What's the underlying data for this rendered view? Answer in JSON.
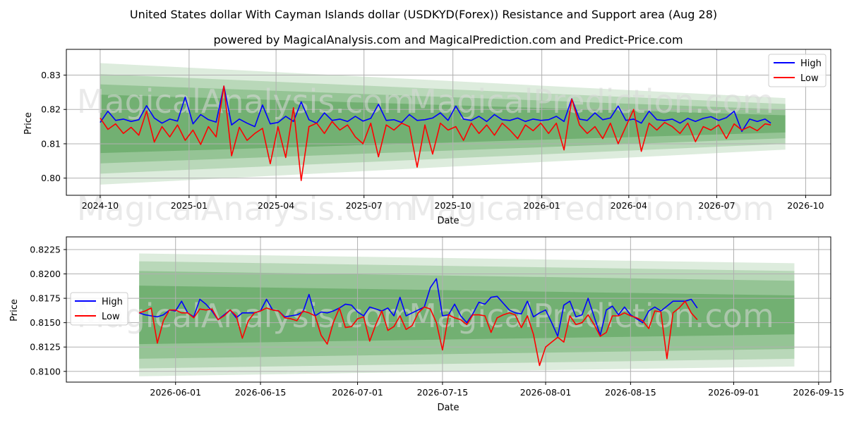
{
  "figure": {
    "title": "United States dollar With Cayman Islands dollar (USDKYD(Forex)) Resistance and Support area (Aug 28)",
    "subtitle": "powered by MagicalAnalysis.com and MagicalPrediction.com and Predict-Price.com",
    "watermarks": [
      "MagicalAnalysis.com",
      "MagicalPrediction.com"
    ]
  },
  "colors": {
    "high": "#0000ff",
    "low": "#ff0000",
    "band": "#2e8b2e",
    "grid": "#b0b0b0"
  },
  "chart_data": [
    {
      "type": "line",
      "xlabel": "Date",
      "ylabel": "Price",
      "x_ticks": [
        "2024-10",
        "2025-01",
        "2025-04",
        "2025-07",
        "2025-10",
        "2026-01",
        "2026-04",
        "2026-07",
        "2026-10"
      ],
      "y_ticks": [
        "0.80",
        "0.81",
        "0.82",
        "0.83"
      ],
      "ylim": [
        0.795,
        0.8375
      ],
      "grid": true,
      "legend": "top-right",
      "bands": {
        "x_range": [
          "2024-10-01",
          "2026-09-10"
        ],
        "center": 0.8158,
        "start_half_widths": [
          0.0177,
          0.0145,
          0.0115,
          0.0085
        ],
        "end_half_widths": [
          0.0075,
          0.0058,
          0.0042,
          0.0025
        ]
      },
      "series": [
        {
          "name": "High",
          "color": "#0000ff",
          "dates": [
            "2024-10-01",
            "2024-10-09",
            "2024-10-17",
            "2024-10-25",
            "2024-11-02",
            "2024-11-10",
            "2024-11-18",
            "2024-11-26",
            "2024-12-04",
            "2024-12-12",
            "2024-12-20",
            "2024-12-28",
            "2025-01-05",
            "2025-01-13",
            "2025-01-21",
            "2025-01-29",
            "2025-02-06",
            "2025-02-14",
            "2025-02-22",
            "2025-03-02",
            "2025-03-10",
            "2025-03-18",
            "2025-03-26",
            "2025-04-03",
            "2025-04-11",
            "2025-04-19",
            "2025-04-27",
            "2025-05-05",
            "2025-05-13",
            "2025-05-21",
            "2025-05-29",
            "2025-06-06",
            "2025-06-14",
            "2025-06-22",
            "2025-06-30",
            "2025-07-08",
            "2025-07-16",
            "2025-07-24",
            "2025-08-01",
            "2025-08-09",
            "2025-08-17",
            "2025-08-25",
            "2025-09-02",
            "2025-09-10",
            "2025-09-18",
            "2025-09-26",
            "2025-10-04",
            "2025-10-12",
            "2025-10-20",
            "2025-10-28",
            "2025-11-05",
            "2025-11-13",
            "2025-11-21",
            "2025-11-29",
            "2025-12-07",
            "2025-12-15",
            "2025-12-23",
            "2025-12-31",
            "2026-01-08",
            "2026-01-16",
            "2026-01-24",
            "2026-02-01",
            "2026-02-09",
            "2026-02-17",
            "2026-02-25",
            "2026-03-05",
            "2026-03-13",
            "2026-03-21",
            "2026-03-29",
            "2026-04-06",
            "2026-04-14",
            "2026-04-22",
            "2026-04-30",
            "2026-05-08",
            "2026-05-16",
            "2026-05-24",
            "2026-06-01",
            "2026-06-09",
            "2026-06-17",
            "2026-06-25",
            "2026-07-03",
            "2026-07-11",
            "2026-07-19",
            "2026-07-27",
            "2026-08-04",
            "2026-08-12",
            "2026-08-20",
            "2026-08-26"
          ],
          "values": [
            0.8162,
            0.8195,
            0.8168,
            0.8172,
            0.8165,
            0.817,
            0.8211,
            0.8175,
            0.816,
            0.8172,
            0.8166,
            0.8236,
            0.8158,
            0.8185,
            0.817,
            0.8163,
            0.8268,
            0.8155,
            0.8172,
            0.816,
            0.815,
            0.8213,
            0.8158,
            0.8162,
            0.818,
            0.8165,
            0.8222,
            0.817,
            0.816,
            0.819,
            0.8168,
            0.8172,
            0.8165,
            0.818,
            0.8166,
            0.8174,
            0.8215,
            0.8168,
            0.817,
            0.8162,
            0.8185,
            0.8168,
            0.817,
            0.8175,
            0.819,
            0.8168,
            0.821,
            0.8172,
            0.8168,
            0.818,
            0.8165,
            0.8185,
            0.817,
            0.8168,
            0.8175,
            0.8165,
            0.8172,
            0.8168,
            0.817,
            0.818,
            0.8165,
            0.8231,
            0.8172,
            0.8168,
            0.819,
            0.817,
            0.8175,
            0.821,
            0.8168,
            0.8172,
            0.816,
            0.8195,
            0.817,
            0.8168,
            0.8172,
            0.816,
            0.8174,
            0.8165,
            0.8174,
            0.8179,
            0.8168,
            0.8176,
            0.8195,
            0.8136,
            0.8172,
            0.8165,
            0.8172,
            0.816
          ]
        },
        {
          "name": "Low",
          "color": "#ff0000",
          "dates": [
            "2024-10-01",
            "2024-10-09",
            "2024-10-17",
            "2024-10-25",
            "2024-11-02",
            "2024-11-10",
            "2024-11-18",
            "2024-11-26",
            "2024-12-04",
            "2024-12-12",
            "2024-12-20",
            "2024-12-28",
            "2025-01-05",
            "2025-01-13",
            "2025-01-21",
            "2025-01-29",
            "2025-02-06",
            "2025-02-14",
            "2025-02-22",
            "2025-03-02",
            "2025-03-10",
            "2025-03-18",
            "2025-03-26",
            "2025-04-03",
            "2025-04-11",
            "2025-04-19",
            "2025-04-27",
            "2025-05-05",
            "2025-05-13",
            "2025-05-21",
            "2025-05-29",
            "2025-06-06",
            "2025-06-14",
            "2025-06-22",
            "2025-06-30",
            "2025-07-08",
            "2025-07-16",
            "2025-07-24",
            "2025-08-01",
            "2025-08-09",
            "2025-08-17",
            "2025-08-25",
            "2025-09-02",
            "2025-09-10",
            "2025-09-18",
            "2025-09-26",
            "2025-10-04",
            "2025-10-12",
            "2025-10-20",
            "2025-10-28",
            "2025-11-05",
            "2025-11-13",
            "2025-11-21",
            "2025-11-29",
            "2025-12-07",
            "2025-12-15",
            "2025-12-23",
            "2025-12-31",
            "2026-01-08",
            "2026-01-16",
            "2026-01-24",
            "2026-02-01",
            "2026-02-09",
            "2026-02-17",
            "2026-02-25",
            "2026-03-05",
            "2026-03-13",
            "2026-03-21",
            "2026-03-29",
            "2026-04-06",
            "2026-04-14",
            "2026-04-22",
            "2026-04-30",
            "2026-05-08",
            "2026-05-16",
            "2026-05-24",
            "2026-06-01",
            "2026-06-09",
            "2026-06-17",
            "2026-06-25",
            "2026-07-03",
            "2026-07-11",
            "2026-07-19",
            "2026-07-27",
            "2026-08-04",
            "2026-08-12",
            "2026-08-20",
            "2026-08-26"
          ],
          "values": [
            0.8175,
            0.8142,
            0.8158,
            0.813,
            0.8148,
            0.8125,
            0.8195,
            0.8105,
            0.815,
            0.812,
            0.8155,
            0.811,
            0.814,
            0.8098,
            0.815,
            0.812,
            0.8268,
            0.8065,
            0.8148,
            0.811,
            0.813,
            0.8145,
            0.8042,
            0.815,
            0.806,
            0.8205,
            0.7993,
            0.815,
            0.816,
            0.813,
            0.8165,
            0.814,
            0.8155,
            0.812,
            0.81,
            0.816,
            0.8062,
            0.8155,
            0.814,
            0.816,
            0.815,
            0.8032,
            0.8155,
            0.807,
            0.816,
            0.814,
            0.815,
            0.811,
            0.816,
            0.813,
            0.8155,
            0.8125,
            0.816,
            0.814,
            0.8115,
            0.8155,
            0.8138,
            0.816,
            0.813,
            0.816,
            0.8082,
            0.823,
            0.8155,
            0.813,
            0.815,
            0.8115,
            0.816,
            0.81,
            0.815,
            0.82,
            0.8078,
            0.816,
            0.814,
            0.8162,
            0.815,
            0.813,
            0.816,
            0.8106,
            0.815,
            0.814,
            0.8155,
            0.8115,
            0.8158,
            0.814,
            0.815,
            0.8138,
            0.8158,
            0.8155
          ]
        }
      ]
    },
    {
      "type": "line",
      "xlabel": "Date",
      "ylabel": "Price",
      "x_ticks": [
        "2026-06-01",
        "2026-06-15",
        "2026-07-01",
        "2026-07-15",
        "2026-08-01",
        "2026-08-15",
        "2026-09-01",
        "2026-09-15"
      ],
      "y_ticks": [
        "0.8100",
        "0.8125",
        "0.8150",
        "0.8175",
        "0.8200",
        "0.8225"
      ],
      "ylim": [
        0.8089,
        0.8238
      ],
      "grid": true,
      "legend": "center-left",
      "bands": {
        "x_range": [
          "2026-05-26",
          "2026-09-11"
        ],
        "center": 0.8158,
        "start_half_widths": [
          0.0063,
          0.0055,
          0.0045,
          0.003
        ],
        "end_half_widths": [
          0.0053,
          0.0045,
          0.0035,
          0.002
        ]
      },
      "series": [
        {
          "name": "High",
          "color": "#0000ff",
          "dates": [
            "2026-05-26",
            "2026-05-27",
            "2026-05-28",
            "2026-05-29",
            "2026-05-30",
            "2026-05-31",
            "2026-06-01",
            "2026-06-02",
            "2026-06-03",
            "2026-06-04",
            "2026-06-05",
            "2026-06-06",
            "2026-06-07",
            "2026-06-08",
            "2026-06-09",
            "2026-06-10",
            "2026-06-11",
            "2026-06-12",
            "2026-06-13",
            "2026-06-14",
            "2026-06-15",
            "2026-06-16",
            "2026-06-17",
            "2026-06-18",
            "2026-06-19",
            "2026-06-20",
            "2026-06-21",
            "2026-06-22",
            "2026-06-23",
            "2026-06-24",
            "2026-06-25",
            "2026-06-26",
            "2026-06-27",
            "2026-06-28",
            "2026-06-29",
            "2026-06-30",
            "2026-07-01",
            "2026-07-02",
            "2026-07-03",
            "2026-07-04",
            "2026-07-05",
            "2026-07-06",
            "2026-07-07",
            "2026-07-08",
            "2026-07-09",
            "2026-07-10",
            "2026-07-11",
            "2026-07-12",
            "2026-07-13",
            "2026-07-14",
            "2026-07-15",
            "2026-07-16",
            "2026-07-17",
            "2026-07-18",
            "2026-07-19",
            "2026-07-20",
            "2026-07-21",
            "2026-07-22",
            "2026-07-23",
            "2026-07-24",
            "2026-07-25",
            "2026-07-26",
            "2026-07-27",
            "2026-07-28",
            "2026-07-29",
            "2026-07-30",
            "2026-07-31",
            "2026-08-01",
            "2026-08-02",
            "2026-08-03",
            "2026-08-04",
            "2026-08-05",
            "2026-08-06",
            "2026-08-07",
            "2026-08-08",
            "2026-08-09",
            "2026-08-10",
            "2026-08-11",
            "2026-08-12",
            "2026-08-13",
            "2026-08-14",
            "2026-08-15",
            "2026-08-16",
            "2026-08-17",
            "2026-08-18",
            "2026-08-19",
            "2026-08-20",
            "2026-08-21",
            "2026-08-22",
            "2026-08-23",
            "2026-08-24",
            "2026-08-25",
            "2026-08-26"
          ],
          "values": [
            0.816,
            0.8158,
            0.8157,
            0.8156,
            0.8158,
            0.8163,
            0.8162,
            0.8172,
            0.816,
            0.8156,
            0.8174,
            0.8169,
            0.8162,
            0.8153,
            0.8158,
            0.8163,
            0.8155,
            0.816,
            0.816,
            0.816,
            0.8162,
            0.8174,
            0.8163,
            0.8162,
            0.8156,
            0.8157,
            0.8158,
            0.8161,
            0.8179,
            0.8157,
            0.8161,
            0.816,
            0.8162,
            0.8165,
            0.8169,
            0.8168,
            0.8161,
            0.8157,
            0.8166,
            0.8164,
            0.8162,
            0.8165,
            0.8157,
            0.8176,
            0.8157,
            0.816,
            0.8163,
            0.8166,
            0.8186,
            0.8195,
            0.8157,
            0.8158,
            0.8169,
            0.8157,
            0.815,
            0.8159,
            0.8171,
            0.8169,
            0.8176,
            0.8177,
            0.817,
            0.8163,
            0.816,
            0.8159,
            0.8172,
            0.8156,
            0.816,
            0.8163,
            0.815,
            0.8136,
            0.8168,
            0.8172,
            0.8156,
            0.8158,
            0.8175,
            0.8156,
            0.8137,
            0.8163,
            0.8167,
            0.8158,
            0.8166,
            0.8158,
            0.8154,
            0.815,
            0.8162,
            0.8166,
            0.8162,
            0.8167,
            0.8172,
            0.8172,
            0.8172,
            0.8174,
            0.8165,
            0.816
          ],
          "note_dates_count": 93
        },
        {
          "name": "Low",
          "color": "#ff0000",
          "dates": [
            "2026-05-26",
            "2026-05-27",
            "2026-05-28",
            "2026-05-29",
            "2026-05-30",
            "2026-05-31",
            "2026-06-01",
            "2026-06-02",
            "2026-06-03",
            "2026-06-04",
            "2026-06-05",
            "2026-06-06",
            "2026-06-07",
            "2026-06-08",
            "2026-06-09",
            "2026-06-10",
            "2026-06-11",
            "2026-06-12",
            "2026-06-13",
            "2026-06-14",
            "2026-06-15",
            "2026-06-16",
            "2026-06-17",
            "2026-06-18",
            "2026-06-19",
            "2026-06-20",
            "2026-06-21",
            "2026-06-22",
            "2026-06-23",
            "2026-06-24",
            "2026-06-25",
            "2026-06-26",
            "2026-06-27",
            "2026-06-28",
            "2026-06-29",
            "2026-06-30",
            "2026-07-01",
            "2026-07-02",
            "2026-07-03",
            "2026-07-04",
            "2026-07-05",
            "2026-07-06",
            "2026-07-07",
            "2026-07-08",
            "2026-07-09",
            "2026-07-10",
            "2026-07-11",
            "2026-07-12",
            "2026-07-13",
            "2026-07-14",
            "2026-07-15",
            "2026-07-16",
            "2026-07-17",
            "2026-07-18",
            "2026-07-19",
            "2026-07-20",
            "2026-07-21",
            "2026-07-22",
            "2026-07-23",
            "2026-07-24",
            "2026-07-25",
            "2026-07-26",
            "2026-07-27",
            "2026-07-28",
            "2026-07-29",
            "2026-07-30",
            "2026-07-31",
            "2026-08-01",
            "2026-08-02",
            "2026-08-03",
            "2026-08-04",
            "2026-08-05",
            "2026-08-06",
            "2026-08-07",
            "2026-08-08",
            "2026-08-09",
            "2026-08-10",
            "2026-08-11",
            "2026-08-12",
            "2026-08-13",
            "2026-08-14",
            "2026-08-15",
            "2026-08-16",
            "2026-08-17",
            "2026-08-18",
            "2026-08-19",
            "2026-08-20",
            "2026-08-21",
            "2026-08-22",
            "2026-08-23",
            "2026-08-24",
            "2026-08-25",
            "2026-08-26"
          ],
          "values": [
            0.816,
            0.8162,
            0.8165,
            0.8129,
            0.8152,
            0.8163,
            0.8163,
            0.816,
            0.816,
            0.8155,
            0.8164,
            0.8163,
            0.8164,
            0.8153,
            0.8157,
            0.8163,
            0.8157,
            0.8134,
            0.8152,
            0.816,
            0.8162,
            0.8165,
            0.8163,
            0.8162,
            0.8155,
            0.8154,
            0.8152,
            0.8162,
            0.816,
            0.8157,
            0.8137,
            0.8128,
            0.815,
            0.8165,
            0.8145,
            0.8146,
            0.8154,
            0.8156,
            0.8131,
            0.8148,
            0.8162,
            0.8142,
            0.8146,
            0.8157,
            0.8143,
            0.8147,
            0.816,
            0.8166,
            0.8164,
            0.815,
            0.8122,
            0.8158,
            0.8155,
            0.8153,
            0.8148,
            0.8158,
            0.8158,
            0.8157,
            0.814,
            0.8155,
            0.8158,
            0.816,
            0.8158,
            0.8145,
            0.8157,
            0.8138,
            0.8106,
            0.8125,
            0.813,
            0.8135,
            0.813,
            0.8157,
            0.8148,
            0.815,
            0.8158,
            0.8148,
            0.8136,
            0.814,
            0.8157,
            0.8157,
            0.816,
            0.8157,
            0.8155,
            0.8152,
            0.8144,
            0.8162,
            0.8161,
            0.8113,
            0.816,
            0.8165,
            0.8172,
            0.816,
            0.8153,
            0.8155
          ]
        }
      ]
    }
  ]
}
